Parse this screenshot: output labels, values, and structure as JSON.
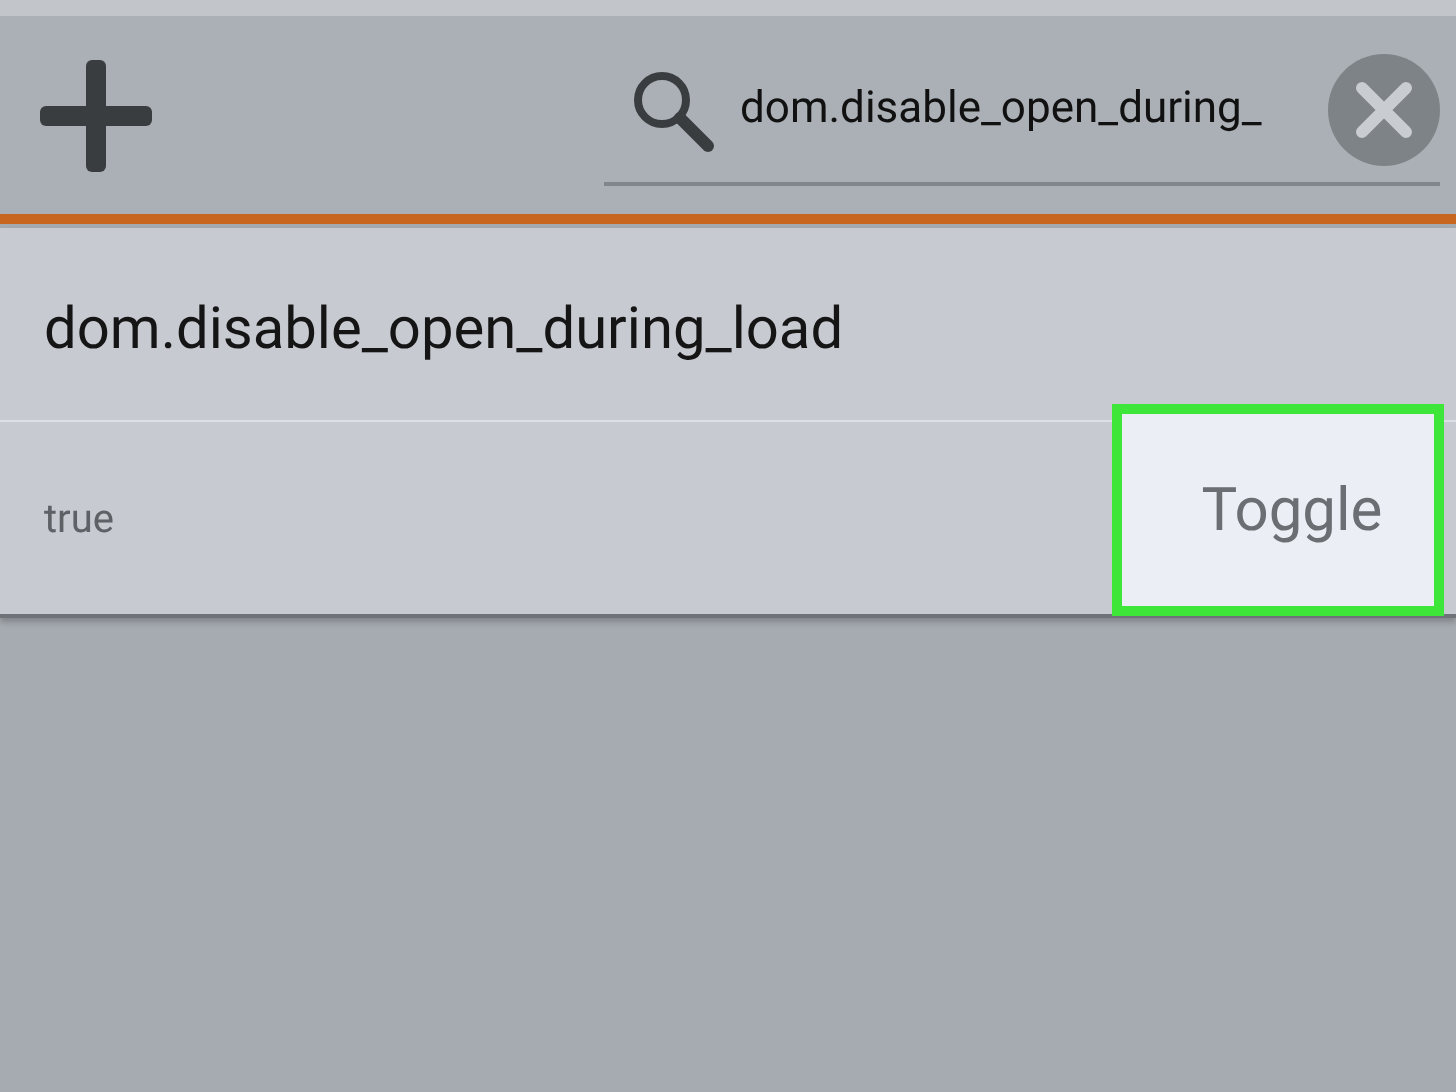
{
  "toolbar": {
    "search": {
      "value": "dom.disable_open_during_"
    }
  },
  "preference": {
    "name": "dom.disable_open_during_load",
    "value": "true",
    "toggle": {
      "label": "Toggle",
      "highlighted": true
    }
  }
}
